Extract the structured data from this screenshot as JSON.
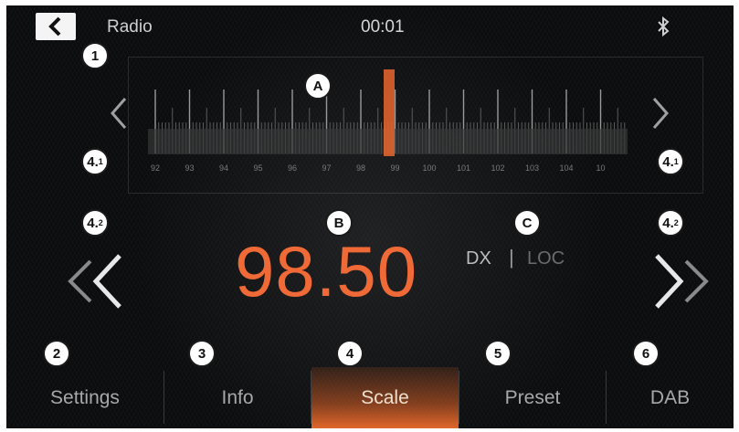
{
  "header": {
    "title": "Radio",
    "clock": "00:01"
  },
  "scale": {
    "labels": [
      "92",
      "93",
      "94",
      "95",
      "96",
      "97",
      "98",
      "99",
      "100",
      "101",
      "102",
      "103",
      "104",
      "10"
    ]
  },
  "tuner": {
    "frequency": "98.50",
    "dx_label": "DX",
    "separator": "|",
    "loc_label": "LOC"
  },
  "tabs": [
    {
      "label": "Settings"
    },
    {
      "label": "Info"
    },
    {
      "label": "Scale"
    },
    {
      "label": "Preset"
    },
    {
      "label": "DAB"
    }
  ],
  "callouts": {
    "c1": "1",
    "c2": "2",
    "c3": "3",
    "c4": "4",
    "c5": "5",
    "c6": "6",
    "cA": "A",
    "cB": "B",
    "cC": "C",
    "c41": "4.",
    "c41_sup": "1",
    "c42": "4.",
    "c42_sup": "2"
  },
  "colors": {
    "accent": "#ef6a36",
    "background": "#0b0c0d"
  }
}
